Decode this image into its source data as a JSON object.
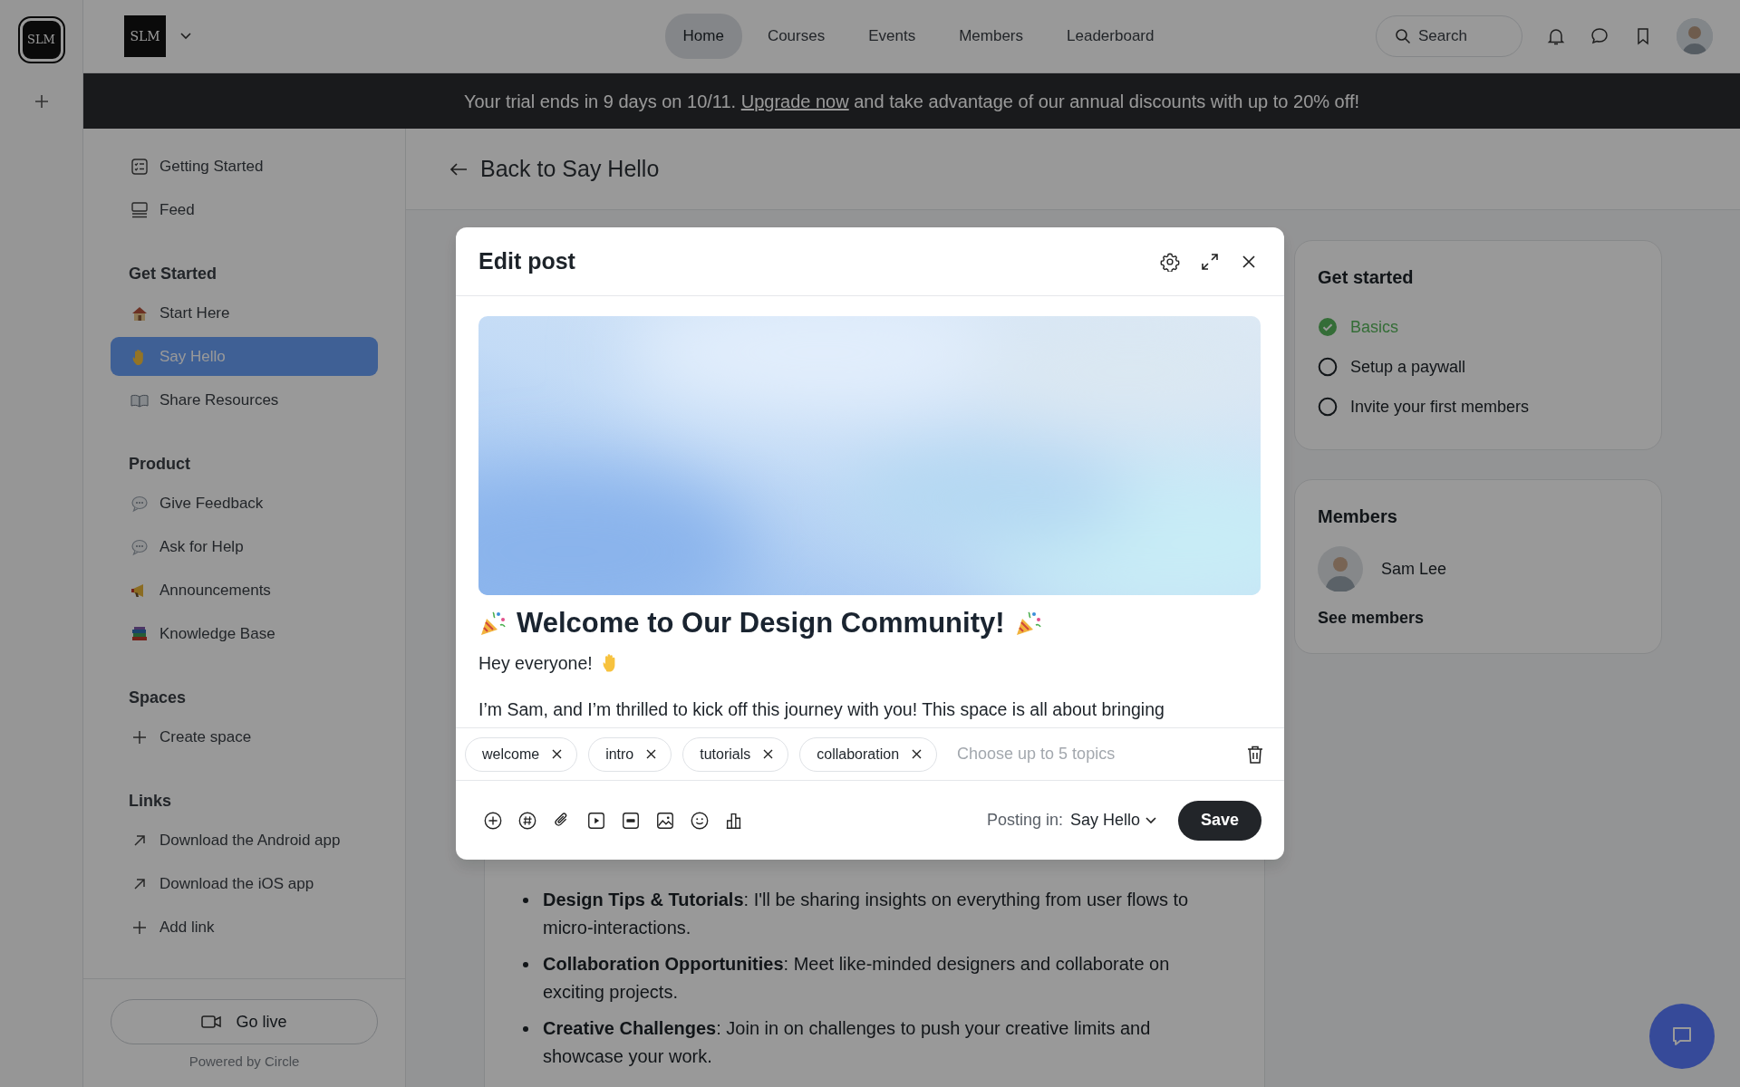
{
  "rail": {
    "logo": "SLM"
  },
  "header": {
    "logo": "SLM",
    "nav": [
      {
        "label": "Home",
        "selected": true
      },
      {
        "label": "Courses",
        "selected": false
      },
      {
        "label": "Events",
        "selected": false
      },
      {
        "label": "Members",
        "selected": false
      },
      {
        "label": "Leaderboard",
        "selected": false
      }
    ],
    "search": {
      "placeholder": "Search"
    }
  },
  "banner": {
    "before": "Your trial ends in 9 days on 10/11.",
    "link": "Upgrade now",
    "after": "and take advantage of our annual discounts with up to 20% off!"
  },
  "sidebar": {
    "top_items": [
      {
        "label": "Getting Started",
        "selected": false
      },
      {
        "label": "Feed",
        "selected": false
      }
    ],
    "sections": [
      {
        "title": "Get Started",
        "items": [
          {
            "label": "Start Here",
            "selected": false
          },
          {
            "label": "Say Hello",
            "selected": true
          },
          {
            "label": "Share Resources",
            "selected": false
          }
        ]
      },
      {
        "title": "Product",
        "items": [
          {
            "label": "Give Feedback",
            "selected": false
          },
          {
            "label": "Ask for Help",
            "selected": false
          },
          {
            "label": "Announcements",
            "selected": false
          },
          {
            "label": "Knowledge Base",
            "selected": false
          }
        ]
      },
      {
        "title": "Spaces",
        "items": [
          {
            "label": "Create space",
            "selected": false
          }
        ]
      },
      {
        "title": "Links",
        "items": [
          {
            "label": "Download the Android app",
            "selected": false
          },
          {
            "label": "Download the iOS app",
            "selected": false
          },
          {
            "label": "Add link",
            "selected": false
          }
        ]
      }
    ],
    "go_live": "Go live",
    "powered_by": "Powered by Circle"
  },
  "back_link": "Back to Say Hello",
  "post": {
    "bullets": [
      "**Design Tips & Tutorials**: I'll be sharing insights on everything from user flows to micro-interactions.",
      "**Collaboration Opportunities**: Meet like-minded designers and collaborate on exciting projects.",
      "**Creative Challenges**: Join in on challenges to push your creative limits and showcase your work."
    ]
  },
  "right_panel": {
    "get_started": {
      "title": "Get started",
      "steps": [
        {
          "label": "Basics",
          "checked": true
        },
        {
          "label": "Setup a paywall",
          "checked": false
        },
        {
          "label": "Invite your first members",
          "checked": false
        }
      ]
    },
    "members": {
      "title": "Members",
      "list": [
        {
          "name": "Sam Lee"
        }
      ],
      "link": "See members"
    }
  },
  "modal": {
    "title": "Edit post",
    "cover": {
      "kind": "picture"
    },
    "post_title": "Welcome to Our Design Community!",
    "greeting": "Hey everyone!",
    "paragraph": "I’m Sam, and I’m thrilled to kick off this journey with you! This space is all about bringing",
    "topics": [
      "welcome",
      "intro",
      "tutorials",
      "collaboration"
    ],
    "topics_placeholder": "Choose up to 5 topics",
    "posting_in_label": "Posting in:",
    "posting_in_space": "Say Hello",
    "save": "Save"
  }
}
